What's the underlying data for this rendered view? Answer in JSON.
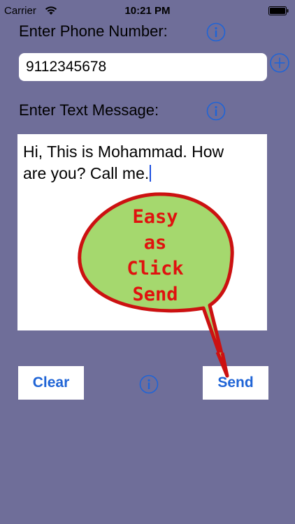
{
  "status_bar": {
    "carrier": "Carrier",
    "time": "10:21 PM"
  },
  "phone": {
    "label": "Enter Phone Number:",
    "value": "9112345678"
  },
  "message": {
    "label": "Enter Text Message:",
    "line1": "Hi, This is Mohammad.  How",
    "line2": "are you?  Call me."
  },
  "bubble": {
    "lines": [
      "Easy",
      "as",
      "Click",
      "Send"
    ]
  },
  "buttons": {
    "clear_label": "Clear",
    "send_label": "Send"
  },
  "icons": {
    "info": "info-icon",
    "add_contact": "plus-circle-icon",
    "wifi": "wifi-icon",
    "battery": "battery-icon"
  },
  "colors": {
    "background": "#6f6e99",
    "accent": "#1f64d6",
    "bubble_fill": "#a5d86e",
    "bubble_border": "#cc1111"
  }
}
